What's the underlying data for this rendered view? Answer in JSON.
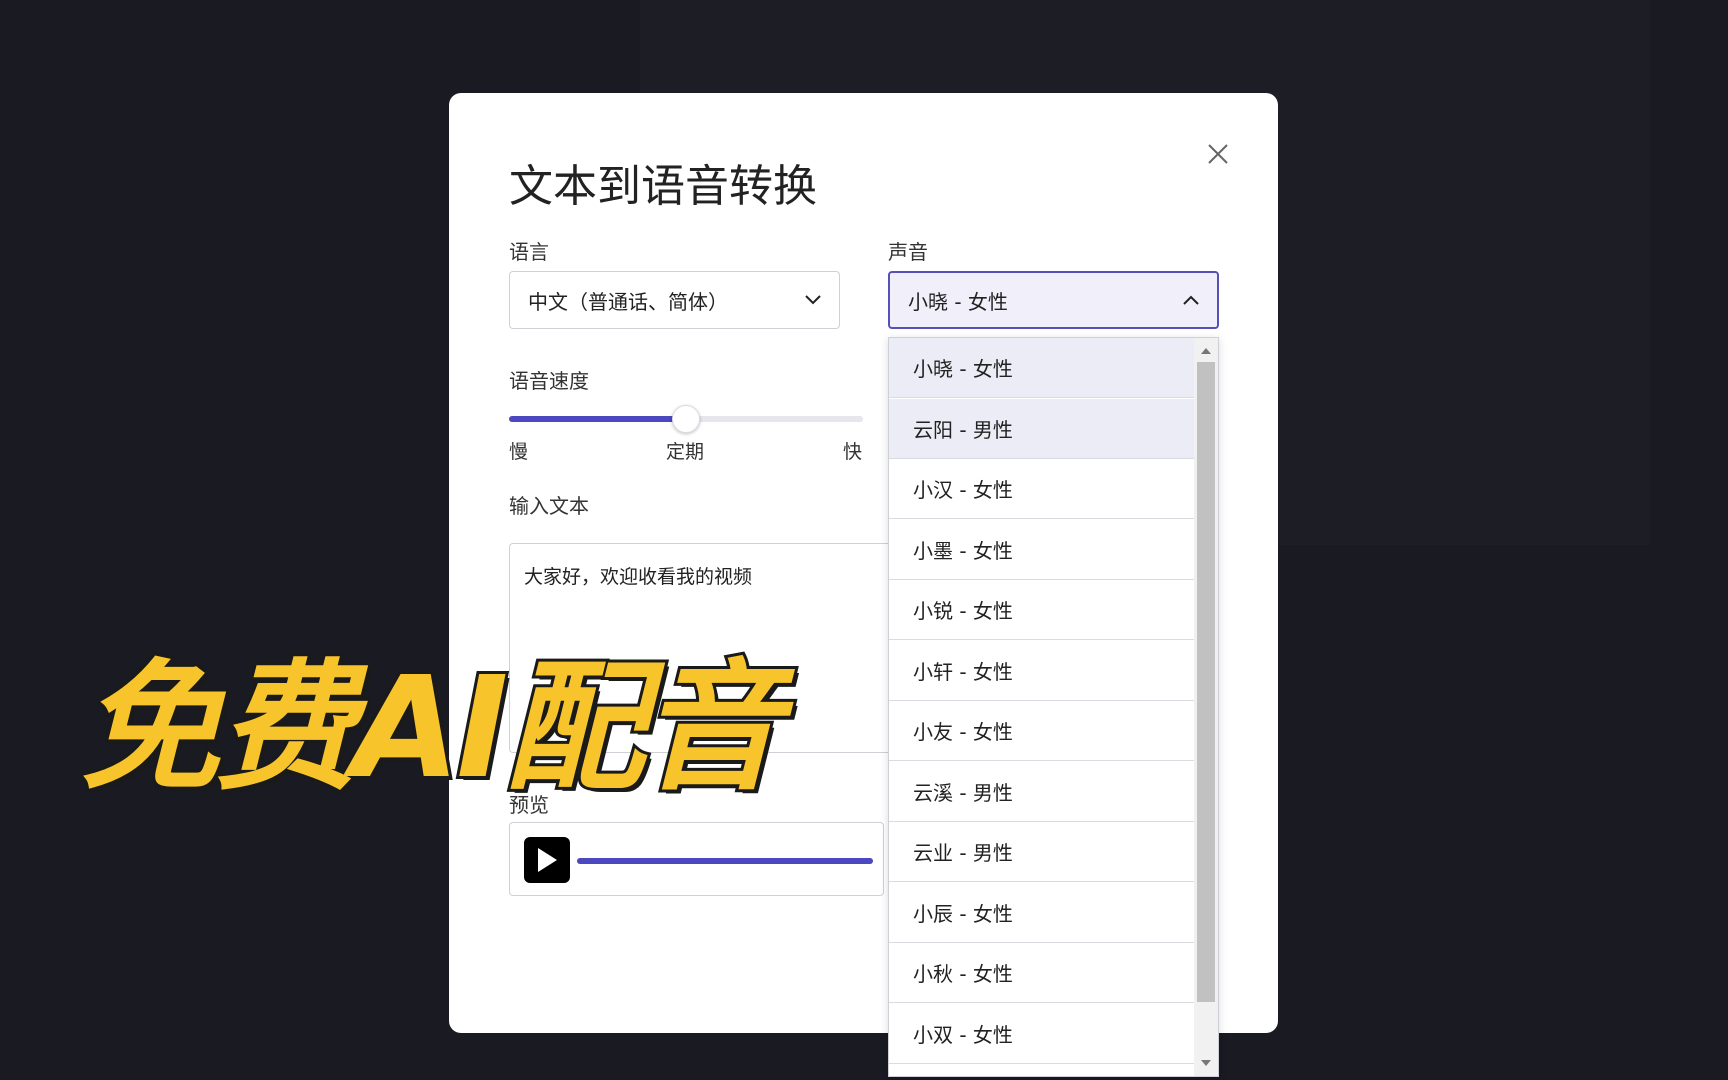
{
  "dialog": {
    "title": "文本到语音转换",
    "close_icon": "close-icon"
  },
  "language": {
    "label": "语言",
    "value": "中文（普通话、简体）"
  },
  "voice": {
    "label": "声音",
    "value": "小晓 - 女性",
    "options": [
      "小晓 - 女性",
      "云阳 - 男性",
      "小汉 - 女性",
      "小墨 - 女性",
      "小锐 - 女性",
      "小轩 - 女性",
      "小友 - 女性",
      "云溪 - 男性",
      "云业 - 男性",
      "小辰 - 女性",
      "小秋 - 女性",
      "小双 - 女性"
    ]
  },
  "speed": {
    "label": "语音速度",
    "slow": "慢",
    "normal": "定期",
    "fast": "快",
    "value_fraction": 0.5
  },
  "input": {
    "label": "输入文本",
    "value": "大家好，欢迎收看我的视频"
  },
  "preview": {
    "label": "预览",
    "progress_fraction": 1.0
  },
  "overlay": {
    "text": "免费AI配音"
  },
  "colors": {
    "accent": "#4b48c0",
    "overlay_text": "#f7c52b",
    "background": "#191a22"
  }
}
